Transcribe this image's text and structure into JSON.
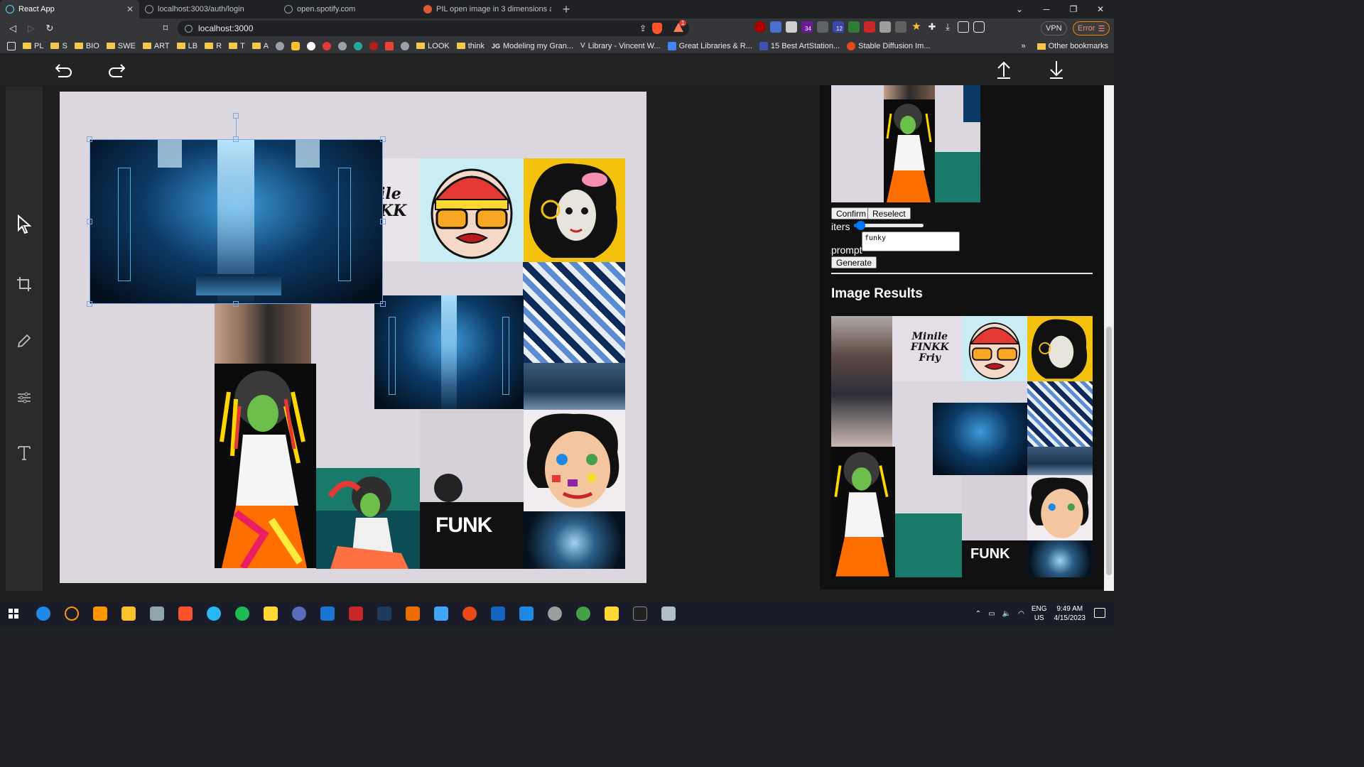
{
  "browser": {
    "tabs": [
      {
        "label": "React App",
        "icon": "react-icon",
        "active": true
      },
      {
        "label": "localhost:3003/auth/login",
        "icon": "globe-icon",
        "active": false
      },
      {
        "label": "open.spotify.com",
        "icon": "globe-icon",
        "active": false
      },
      {
        "label": "PIL open image in 3 dimensions at Du",
        "icon": "duckduckgo-icon",
        "active": false
      }
    ],
    "url": "localhost:3000",
    "vpn_label": "VPN",
    "error_label": "Error",
    "extension_badges": {
      "brave_rewards": "1",
      "ext_34": "34",
      "ext_12": "12"
    },
    "bookmarks": [
      {
        "label": "",
        "type": "apps"
      },
      {
        "label": "PL",
        "type": "folder"
      },
      {
        "label": "S",
        "type": "folder"
      },
      {
        "label": "BIO",
        "type": "folder"
      },
      {
        "label": "SWE",
        "type": "folder"
      },
      {
        "label": "ART",
        "type": "folder"
      },
      {
        "label": "LB",
        "type": "folder"
      },
      {
        "label": "R",
        "type": "folder"
      },
      {
        "label": "T",
        "type": "folder"
      },
      {
        "label": "A",
        "type": "folder"
      },
      {
        "label": "LOOK",
        "type": "folder"
      },
      {
        "label": "think",
        "type": "folder"
      },
      {
        "label": "Modeling my Gran...",
        "type": "site"
      },
      {
        "label": "Library - Vincent W...",
        "type": "site"
      },
      {
        "label": "Great Libraries & R...",
        "type": "site"
      },
      {
        "label": "15 Best ArtStation...",
        "type": "site"
      },
      {
        "label": "Stable Diffusion Im...",
        "type": "site"
      }
    ],
    "bookmarks_overflow": "»",
    "other_bookmarks": "Other bookmarks"
  },
  "editor": {
    "tools": [
      "select-tool",
      "crop-tool",
      "pencil-tool",
      "adjust-tool",
      "text-tool"
    ],
    "colors": {
      "accent": "#7aa7e0",
      "canvas_bg": "#dcd7df",
      "panel_bg": "#111111"
    }
  },
  "panel": {
    "confirm_label": "Confirm",
    "reselect_label": "Reselect",
    "iters_label": "iters",
    "iters_value": 0.05,
    "prompt_label": "prompt",
    "prompt_value": "funky",
    "generate_label": "Generate",
    "results_title": "Image Results"
  },
  "canvas_text": {
    "poster_top": "ile\nKK",
    "poster_bottom": "FUNK",
    "results_poster": "Minile\nFINKK\nFriy",
    "results_funk": "FUNK"
  },
  "taskbar": {
    "language": "ENG",
    "region": "US",
    "time": "9:49 AM",
    "date": "4/15/2023"
  }
}
